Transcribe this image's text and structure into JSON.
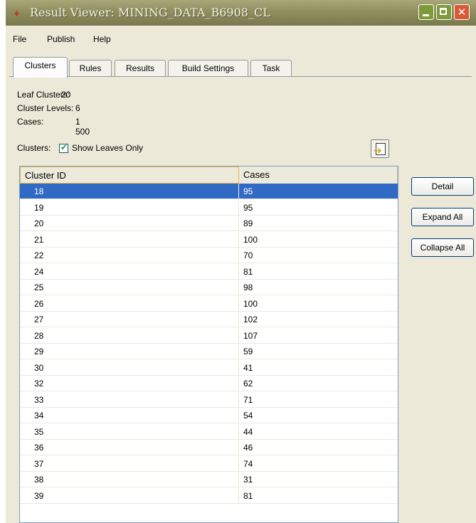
{
  "window": {
    "title": "Result Viewer: MINING_DATA_B6908_CL",
    "title_icon": "diamond-app-icon"
  },
  "menu": {
    "items": [
      {
        "label": "File"
      },
      {
        "label": "Publish"
      },
      {
        "label": "Help"
      }
    ]
  },
  "tabs": [
    {
      "label": "Clusters",
      "active": true
    },
    {
      "label": "Rules"
    },
    {
      "label": "Results"
    },
    {
      "label": "Build Settings"
    },
    {
      "label": "Task"
    }
  ],
  "info": {
    "leaf_clusters_label": "Leaf Clusters:",
    "leaf_clusters_value": "20",
    "cluster_levels_label": "Cluster Levels:",
    "cluster_levels_value": "6",
    "cases_label": "Cases:",
    "cases_value": "1 500"
  },
  "clusters_filter": {
    "label": "Clusters:",
    "checkbox_label": "Show Leaves Only",
    "checked": true
  },
  "table": {
    "headers": [
      "Cluster ID",
      "Cases"
    ],
    "rows": [
      [
        "18",
        "95"
      ],
      [
        "19",
        "95"
      ],
      [
        "20",
        "89"
      ],
      [
        "21",
        "100"
      ],
      [
        "22",
        "70"
      ],
      [
        "24",
        "81"
      ],
      [
        "25",
        "98"
      ],
      [
        "26",
        "100"
      ],
      [
        "27",
        "102"
      ],
      [
        "28",
        "107"
      ],
      [
        "29",
        "59"
      ],
      [
        "30",
        "41"
      ],
      [
        "32",
        "62"
      ],
      [
        "33",
        "71"
      ],
      [
        "34",
        "54"
      ],
      [
        "35",
        "44"
      ],
      [
        "36",
        "46"
      ],
      [
        "37",
        "74"
      ],
      [
        "38",
        "31"
      ],
      [
        "39",
        "81"
      ]
    ],
    "selected_row": 0
  },
  "buttons": {
    "detail": "Detail",
    "expand_all": "Expand All",
    "collapse_all": "Collapse All"
  },
  "colors": {
    "selection": "#316ac5",
    "titlebar": "#8e8e5e",
    "window_bg": "#ece9d8"
  }
}
